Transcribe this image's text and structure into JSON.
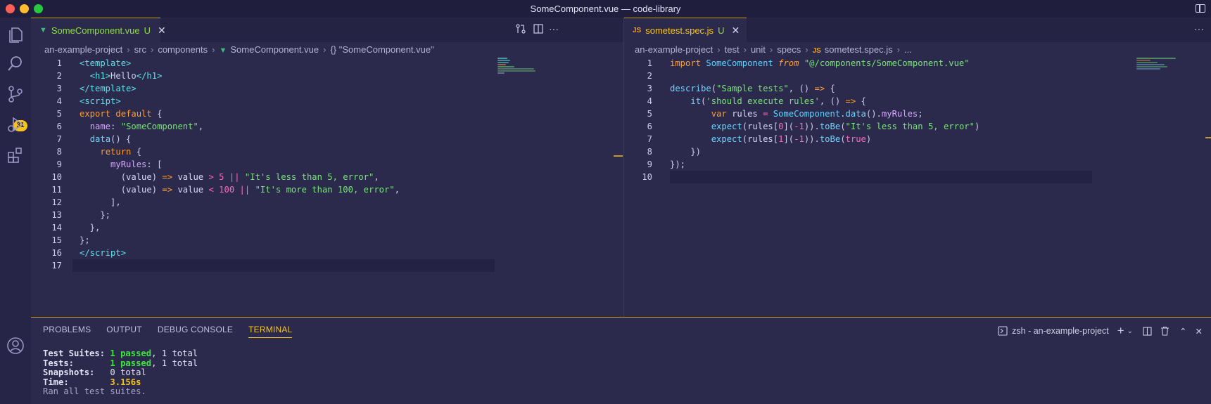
{
  "window": {
    "title": "SomeComponent.vue — code-library"
  },
  "activity": {
    "badge": "31"
  },
  "left": {
    "tab": {
      "name": "SomeComponent.vue",
      "status": "U"
    },
    "breadcrumb": [
      "an-example-project",
      "src",
      "components",
      "SomeComponent.vue",
      "{} \"SomeComponent.vue\""
    ],
    "line_numbers": [
      "1",
      "2",
      "3",
      "4",
      "5",
      "6",
      "7",
      "8",
      "9",
      "10",
      "11",
      "12",
      "13",
      "14",
      "15",
      "16",
      "17"
    ]
  },
  "right": {
    "tab": {
      "name": "sometest.spec.js",
      "status": "U",
      "icon": "JS"
    },
    "breadcrumb": [
      "an-example-project",
      "test",
      "unit",
      "specs",
      "sometest.spec.js",
      "..."
    ],
    "line_numbers": [
      "1",
      "2",
      "3",
      "4",
      "5",
      "6",
      "7",
      "8",
      "9",
      "10"
    ]
  },
  "panel": {
    "tabs": [
      "PROBLEMS",
      "OUTPUT",
      "DEBUG CONSOLE",
      "TERMINAL"
    ],
    "active_tab": "TERMINAL",
    "terminal_name": "zsh - an-example-project",
    "output": {
      "suites_label": "Test Suites:",
      "suites_pass": "1 passed",
      "suites_total": ", 1 total",
      "tests_label": "Tests:",
      "tests_pass": "1 passed",
      "tests_total": ", 1 total",
      "snap_label": "Snapshots:",
      "snap_value": "0 total",
      "time_label": "Time:",
      "time_value": "3.156s",
      "footer": "Ran all test suites."
    }
  },
  "colors": {
    "accent": "#f7c518",
    "tab_border": "#c69b25",
    "background": "#2b2a4c"
  },
  "icons": [
    "files-icon",
    "search-icon",
    "source-control-icon",
    "run-debug-icon",
    "extensions-icon",
    "account-icon"
  ]
}
